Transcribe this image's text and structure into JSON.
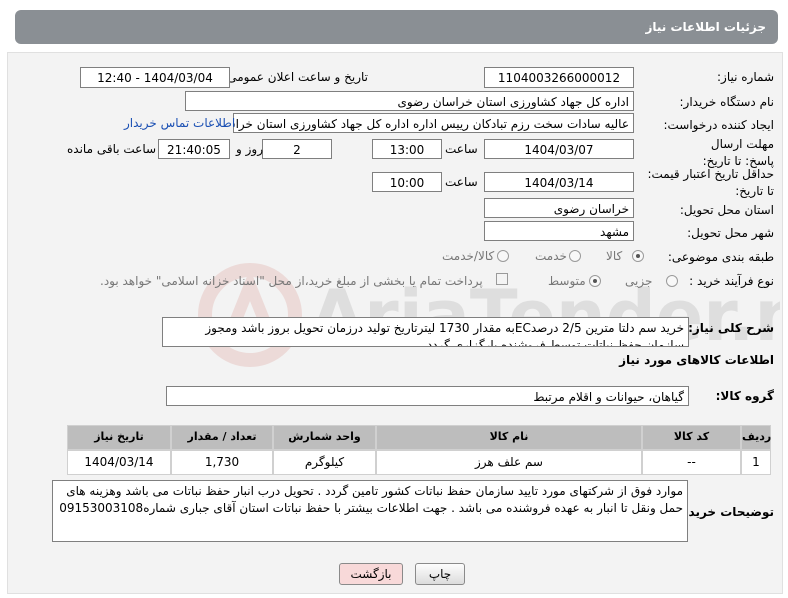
{
  "header": {
    "title": "جزئیات اطلاعات نیاز"
  },
  "fields": {
    "need_number": {
      "label": "شماره نیاز:",
      "value": "1104003266000012"
    },
    "announce_datetime": {
      "label": "تاریخ و ساعت اعلان عمومی:",
      "value": "1404/03/04 - 12:40"
    },
    "buyer_org": {
      "label": "نام دستگاه خریدار:",
      "value": "اداره کل جهاد کشاورزی استان خراسان رضوی"
    },
    "requester": {
      "label": "ایجاد کننده درخواست:",
      "value": "عالیه سادات سخت رزم تبادکان رییس اداره  اداره کل جهاد کشاورزی استان خراسان رضوی",
      "contact_link": "اطلاعات تماس خریدار"
    },
    "reply_deadline": {
      "label": "مهلت ارسال پاسخ: تا تاریخ:",
      "date": "1404/03/07",
      "time_label": "ساعت",
      "time": "13:00",
      "days": "2",
      "days_label": "روز و",
      "remaining": "21:40:05",
      "remaining_label": "ساعت باقی مانده"
    },
    "price_validity": {
      "label": "حداقل تاریخ اعتبار قیمت: تا تاریخ:",
      "date": "1404/03/14",
      "time_label": "ساعت",
      "time": "10:00"
    },
    "delivery_province": {
      "label": "استان محل تحویل:",
      "value": "خراسان رضوی"
    },
    "delivery_city": {
      "label": "شهر محل تحویل:",
      "value": "مشهد"
    },
    "category": {
      "label": "طبقه بندی موضوعی:",
      "options": [
        "کالا",
        "خدمت",
        "کالا/خدمت"
      ],
      "selected": "کالا"
    },
    "purchase_type": {
      "label": "نوع فرآیند خرید :",
      "options": [
        "جزیی",
        "متوسط"
      ],
      "selected": "متوسط",
      "note": "پرداخت تمام یا بخشی از مبلغ خرید،از محل \"اسناد خزانه اسلامی\" خواهد بود."
    }
  },
  "description": {
    "label": "شرح کلی نیاز:",
    "text": "خرید سم دلتا مترین 2/5 درصدECبه مقدار 1730 لیترتاریخ تولید درزمان تحویل بروز باشد ومجوز سازمان حفظ نباتات توسط فروشنده بارگزاری گردد ."
  },
  "goods_section": {
    "title": "اطلاعات کالاهای مورد نیاز",
    "group_label": "گروه کالا:",
    "group_value": "گیاهان، حیوانات و اقلام مرتبط",
    "table": {
      "headers": [
        "ردیف",
        "کد کالا",
        "نام کالا",
        "واحد شمارش",
        "تعداد / مقدار",
        "تاریخ نیاز"
      ],
      "rows": [
        [
          "1",
          "--",
          "سم علف هرز",
          "کیلوگرم",
          "1,730",
          "1404/03/14"
        ]
      ]
    }
  },
  "buyer_notes": {
    "label": "توضیحات خریدار:",
    "text": "موارد فوق از شرکتهای مورد تایید سازمان حفظ نباتات کشور تامین گردد . تحویل درب انبار حفظ نباتات می باشد وهزینه های حمل ونقل تا انبار به عهده فروشنده می باشد . جهت اطلاعات بیشتر با حفظ نباتات استان آقای جباری شماره09153003108"
  },
  "buttons": {
    "print": "چاپ",
    "back": "بازگشت"
  },
  "colors": {
    "header_bg": "#8a8f94",
    "table_head_bg": "#bdbdbd",
    "link": "#1a4fb3",
    "back_btn": "#f8d9d9"
  }
}
